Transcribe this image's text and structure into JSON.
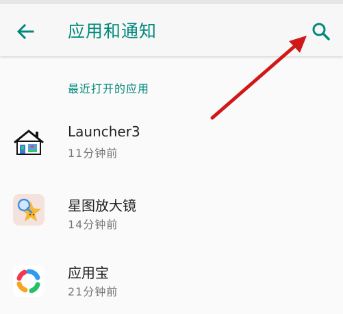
{
  "toolbar": {
    "title": "应用和通知",
    "back_icon": "arrow-left-icon",
    "search_icon": "search-icon"
  },
  "section": {
    "header": "最近打开的应用"
  },
  "apps": [
    {
      "name": "Launcher3",
      "time": "11分钟前",
      "icon": "launcher3-house-icon"
    },
    {
      "name": "星图放大镜",
      "time": "14分钟前",
      "icon": "magnifier-star-icon"
    },
    {
      "name": "应用宝",
      "time": "21分钟前",
      "icon": "yingyongbao-icon"
    }
  ],
  "colors": {
    "accent": "#00897b",
    "primary_text": "#212121",
    "secondary_text": "#757575",
    "annotation_arrow": "#d01818"
  }
}
